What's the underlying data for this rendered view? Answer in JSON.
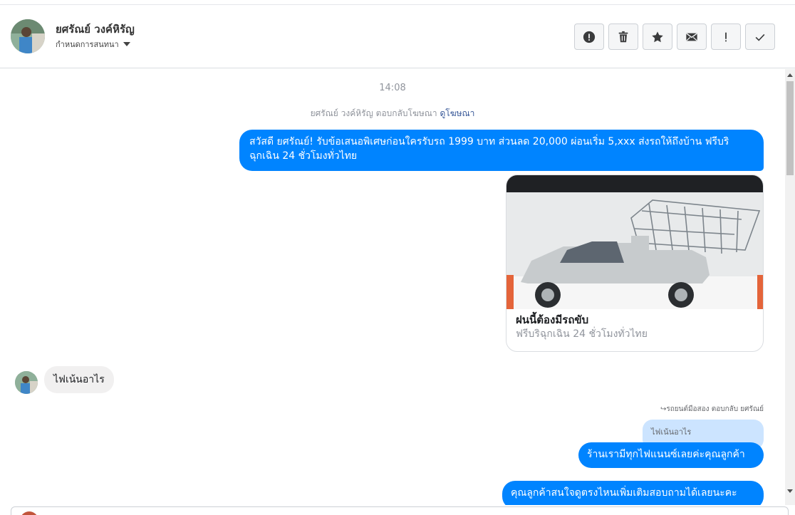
{
  "header": {
    "contact_name": "ยศรัณย์ วงค์หิรัญ",
    "conversation_setting": "กำหนดการสนทนา",
    "actions": [
      {
        "name": "spam",
        "icon": "alert-circle-icon"
      },
      {
        "name": "delete",
        "icon": "trash-icon"
      },
      {
        "name": "star",
        "icon": "star-icon"
      },
      {
        "name": "mark-unread",
        "icon": "envelope-icon"
      },
      {
        "name": "follow-up",
        "icon": "exclamation-icon"
      },
      {
        "name": "done",
        "icon": "check-icon"
      }
    ]
  },
  "thread": {
    "timestamp": "14:08",
    "ad_reply_text": "ยศรัณย์ วงค์หิรัญ ตอบกลับโฆษณา",
    "ad_reply_link": "ดูโฆษณา",
    "messages": {
      "outgoing_1": "สวัสดี ยศรัณย์! รับข้อเสนอพิเศษก่อนใครรับรถ 1999 บาท ส่วนลด 20,000  ผ่อนเริ่ม 5,xxx ส่งรถให้ถึงบ้าน ฟรีบริ ฉุกเฉิน 24 ชั่วโมงทั่วไทย",
      "card_title": "ฝนนี้ต้องมีรถขับ",
      "card_subtitle": "ฟรีบริฉุกเฉิน 24 ชั่วโมงทั่วไทย",
      "incoming_1": "ไฟเน้นอาไร",
      "reply_meta": "รถยนต์มือสอง ตอบกลับ ยศรัณย์",
      "quoted_text": "ไฟเน้นอาไร",
      "outgoing_2": "ร้านเรามีทุกไฟแนนซ์เลยค่ะคุณลูกค้า",
      "outgoing_3": "คุณลูกค้าสนใจดูตรงไหนเพิ่มเติมสอบถามได้เลยนะคะ"
    }
  },
  "colors": {
    "outgoing_bubble": "#0084ff",
    "incoming_bubble": "#f1f0f0",
    "quoted_bubble": "#cce4ff",
    "link": "#385898"
  }
}
